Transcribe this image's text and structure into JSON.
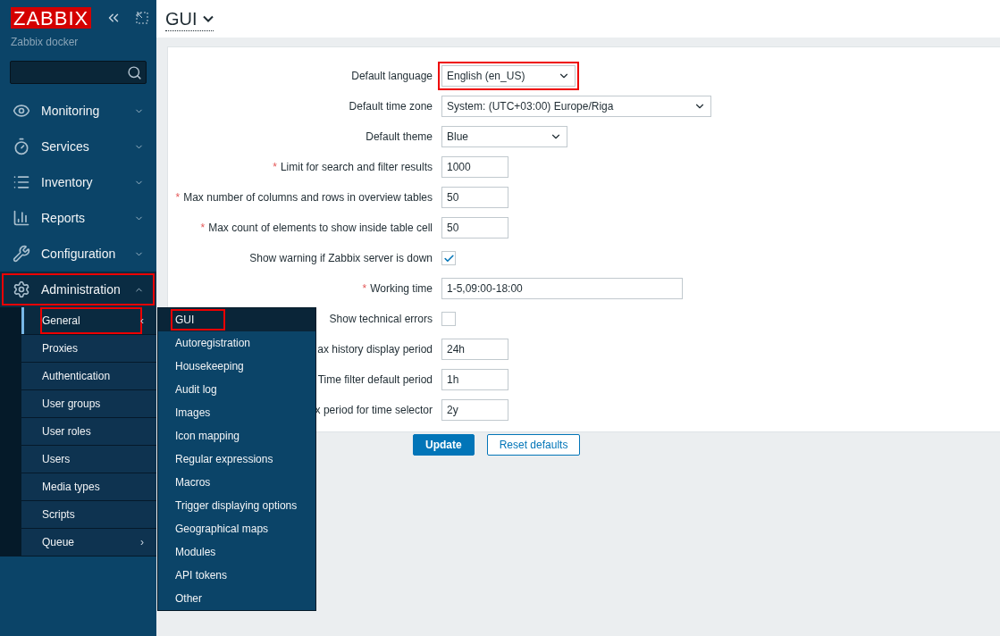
{
  "sidebar": {
    "logo": "ZABBIX",
    "server_name": "Zabbix docker",
    "menu": [
      {
        "label": "Monitoring",
        "expanded": false,
        "highlighted": false
      },
      {
        "label": "Services",
        "expanded": false,
        "highlighted": false
      },
      {
        "label": "Inventory",
        "expanded": false,
        "highlighted": false
      },
      {
        "label": "Reports",
        "expanded": false,
        "highlighted": false
      },
      {
        "label": "Configuration",
        "expanded": false,
        "highlighted": false
      },
      {
        "label": "Administration",
        "expanded": true,
        "highlighted": true
      }
    ],
    "submenu": [
      {
        "label": "General",
        "selected": true,
        "highlighted": true,
        "arrow": "‹"
      },
      {
        "label": "Proxies",
        "selected": false,
        "highlighted": false
      },
      {
        "label": "Authentication",
        "selected": false,
        "highlighted": false
      },
      {
        "label": "User groups",
        "selected": false,
        "highlighted": false
      },
      {
        "label": "User roles",
        "selected": false,
        "highlighted": false
      },
      {
        "label": "Users",
        "selected": false,
        "highlighted": false
      },
      {
        "label": "Media types",
        "selected": false,
        "highlighted": false
      },
      {
        "label": "Scripts",
        "selected": false,
        "highlighted": false
      },
      {
        "label": "Queue",
        "selected": false,
        "highlighted": false,
        "arrow": "›"
      }
    ],
    "flyout": [
      {
        "label": "GUI",
        "selected": true,
        "highlighted": true
      },
      {
        "label": "Autoregistration",
        "selected": false,
        "highlighted": false
      },
      {
        "label": "Housekeeping",
        "selected": false,
        "highlighted": false
      },
      {
        "label": "Audit log",
        "selected": false,
        "highlighted": false
      },
      {
        "label": "Images",
        "selected": false,
        "highlighted": false
      },
      {
        "label": "Icon mapping",
        "selected": false,
        "highlighted": false
      },
      {
        "label": "Regular expressions",
        "selected": false,
        "highlighted": false
      },
      {
        "label": "Macros",
        "selected": false,
        "highlighted": false
      },
      {
        "label": "Trigger displaying options",
        "selected": false,
        "highlighted": false
      },
      {
        "label": "Geographical maps",
        "selected": false,
        "highlighted": false
      },
      {
        "label": "Modules",
        "selected": false,
        "highlighted": false
      },
      {
        "label": "API tokens",
        "selected": false,
        "highlighted": false
      },
      {
        "label": "Other",
        "selected": false,
        "highlighted": false
      }
    ]
  },
  "header": {
    "title": "GUI"
  },
  "form": {
    "rows": [
      {
        "kind": "select",
        "label": "Default language",
        "value": "English (en_US)",
        "highlighted": true
      },
      {
        "kind": "select",
        "label": "Default time zone",
        "value": "System: (UTC+03:00) Europe/Riga",
        "highlighted": false
      },
      {
        "kind": "select",
        "label": "Default theme",
        "value": "Blue",
        "highlighted": false
      },
      {
        "kind": "input",
        "required_mark": "*",
        "label": "Limit for search and filter results",
        "value": "1000"
      },
      {
        "kind": "input",
        "required_mark": "*",
        "label": "Max number of columns and rows in overview tables",
        "value": "50"
      },
      {
        "kind": "input",
        "required_mark": "*",
        "label": "Max count of elements to show inside table cell",
        "value": "50"
      },
      {
        "kind": "checkbox",
        "label": "Show warning if Zabbix server is down",
        "checked": true
      },
      {
        "kind": "input",
        "required_mark": "*",
        "label": "Working time",
        "value": "1-5,09:00-18:00"
      },
      {
        "kind": "checkbox",
        "label": "Show technical errors",
        "checked": false
      },
      {
        "kind": "input",
        "label": "ax history display period",
        "value": "24h"
      },
      {
        "kind": "input",
        "label": "Time filter default period",
        "value": "1h"
      },
      {
        "kind": "input",
        "label": "x period for time selector",
        "value": "2y"
      }
    ],
    "buttons": [
      {
        "label": "Update",
        "kind": "primary"
      },
      {
        "label": "Reset defaults",
        "kind": "secondary"
      }
    ]
  }
}
